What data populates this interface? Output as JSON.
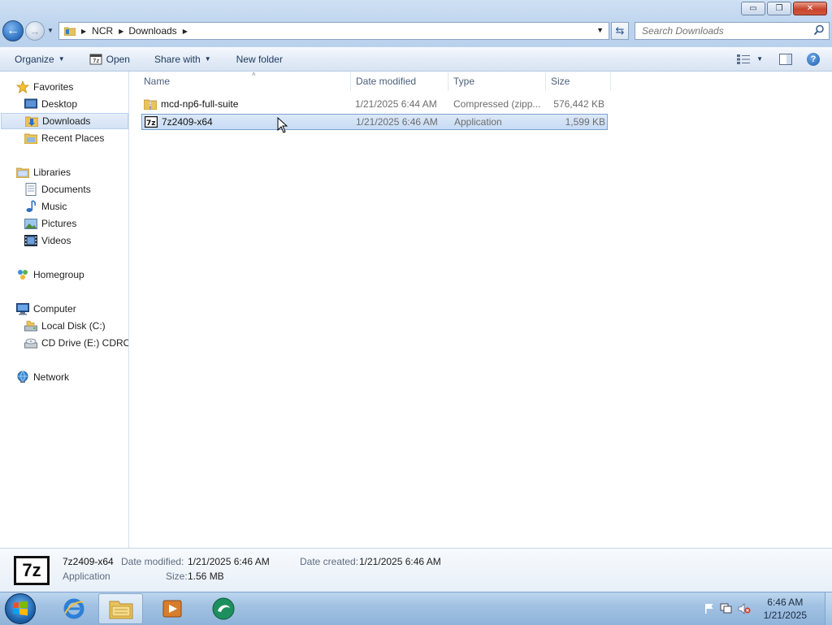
{
  "window": {
    "buttons": {
      "minimize": "▭",
      "maximize": "❐",
      "close": "✕"
    }
  },
  "address": {
    "crumbs": [
      "NCR",
      "Downloads"
    ]
  },
  "search": {
    "placeholder": "Search Downloads"
  },
  "command_bar": {
    "organize": "Organize",
    "open": "Open",
    "share_with": "Share with",
    "new_folder": "New folder"
  },
  "nav": {
    "favorites": "Favorites",
    "desktop": "Desktop",
    "downloads": "Downloads",
    "recent_places": "Recent Places",
    "libraries": "Libraries",
    "documents": "Documents",
    "music": "Music",
    "pictures": "Pictures",
    "videos": "Videos",
    "homegroup": "Homegroup",
    "computer": "Computer",
    "local_disk": "Local Disk (C:)",
    "cd_drive": "CD Drive (E:) CDROM",
    "network": "Network"
  },
  "columns": {
    "name": "Name",
    "date_modified": "Date modified",
    "type": "Type",
    "size": "Size"
  },
  "files": [
    {
      "name": "mcd-np6-full-suite",
      "date": "1/21/2025 6:44 AM",
      "type": "Compressed (zipp...",
      "size": "576,442 KB",
      "icon": "zip-folder-icon"
    },
    {
      "name": "7z2409-x64",
      "date": "1/21/2025 6:46 AM",
      "type": "Application",
      "size": "1,599 KB",
      "icon": "7zip-installer-icon",
      "selected": true
    }
  ],
  "details": {
    "icon_text": "7z",
    "name": "7z2409-x64",
    "kind": "Application",
    "date_modified_label": "Date modified:",
    "date_modified": "1/21/2025 6:46 AM",
    "date_created_label": "Date created:",
    "date_created": "1/21/2025 6:46 AM",
    "size_label": "Size:",
    "size": "1.56 MB"
  },
  "taskbar": {
    "time": "6:46 AM",
    "date": "1/21/2025"
  }
}
